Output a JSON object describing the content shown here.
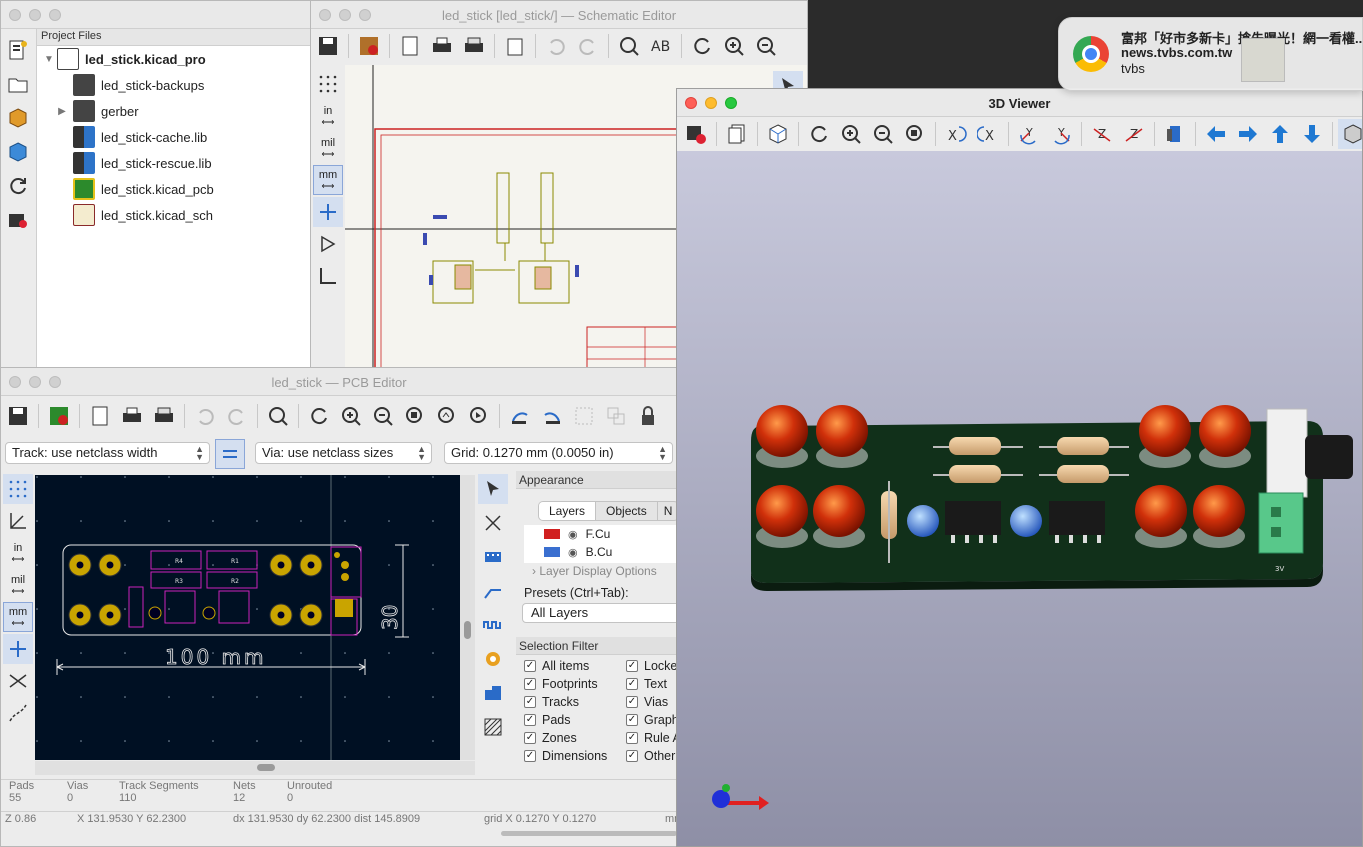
{
  "project_manager": {
    "tree_header": "Project Files",
    "project": "led_stick.kicad_pro",
    "files": [
      {
        "name": "led_stick-backups",
        "kind": "folder"
      },
      {
        "name": "gerber",
        "kind": "folder"
      },
      {
        "name": "led_stick-cache.lib",
        "kind": "lib"
      },
      {
        "name": "led_stick-rescue.lib",
        "kind": "lib"
      },
      {
        "name": "led_stick.kicad_pcb",
        "kind": "pcb"
      },
      {
        "name": "led_stick.kicad_sch",
        "kind": "sch"
      }
    ]
  },
  "schematic": {
    "title": "led_stick [led_stick/] — Schematic Editor",
    "units": {
      "in": "in",
      "mil": "mil",
      "mm": "mm"
    }
  },
  "pcb": {
    "title": "led_stick — PCB Editor",
    "track_select": "Track: use netclass width",
    "via_select": "Via: use netclass sizes",
    "grid_select": "Grid: 0.1270 mm (0.0050 in)",
    "units": {
      "in": "in",
      "mil": "mil",
      "mm": "mm"
    },
    "dimension_h": "100 mm",
    "dimension_v": "30",
    "appearance": {
      "header": "Appearance",
      "tabs": [
        "Layers",
        "Objects",
        "N"
      ],
      "layers": [
        {
          "name": "F.Cu",
          "color": "#d11f1f"
        },
        {
          "name": "B.Cu",
          "color": "#3a6fd0"
        }
      ],
      "layer_display_options": "Layer Display Options",
      "presets_label": "Presets (Ctrl+Tab):",
      "presets_value": "All Layers"
    },
    "selection_filter": {
      "header": "Selection Filter",
      "left": [
        "All items",
        "Footprints",
        "Tracks",
        "Pads",
        "Zones",
        "Dimensions"
      ],
      "right": [
        "Locke",
        "Text",
        "Vias",
        "Graph",
        "Rule A",
        "Other"
      ]
    },
    "stats": [
      {
        "label": "Pads",
        "value": "55"
      },
      {
        "label": "Vias",
        "value": "0"
      },
      {
        "label": "Track Segments",
        "value": "110"
      },
      {
        "label": "Nets",
        "value": "12"
      },
      {
        "label": "Unrouted",
        "value": "0"
      }
    ],
    "statusbar": {
      "zoom": "Z 0.86",
      "xy": "X 131.9530  Y 62.2300",
      "dxy": "dx 131.9530  dy 62.2300  dist 145.8909",
      "grid": "grid X 0.1270  Y 0.1270",
      "units": "mm"
    }
  },
  "viewer3d": {
    "title": "3D Viewer",
    "board_label": "3V"
  },
  "notification": {
    "title": "富邦「好市多新卡」搶先曝光！網一看權...",
    "site": "news.tvbs.com.tw",
    "source": "tvbs"
  }
}
